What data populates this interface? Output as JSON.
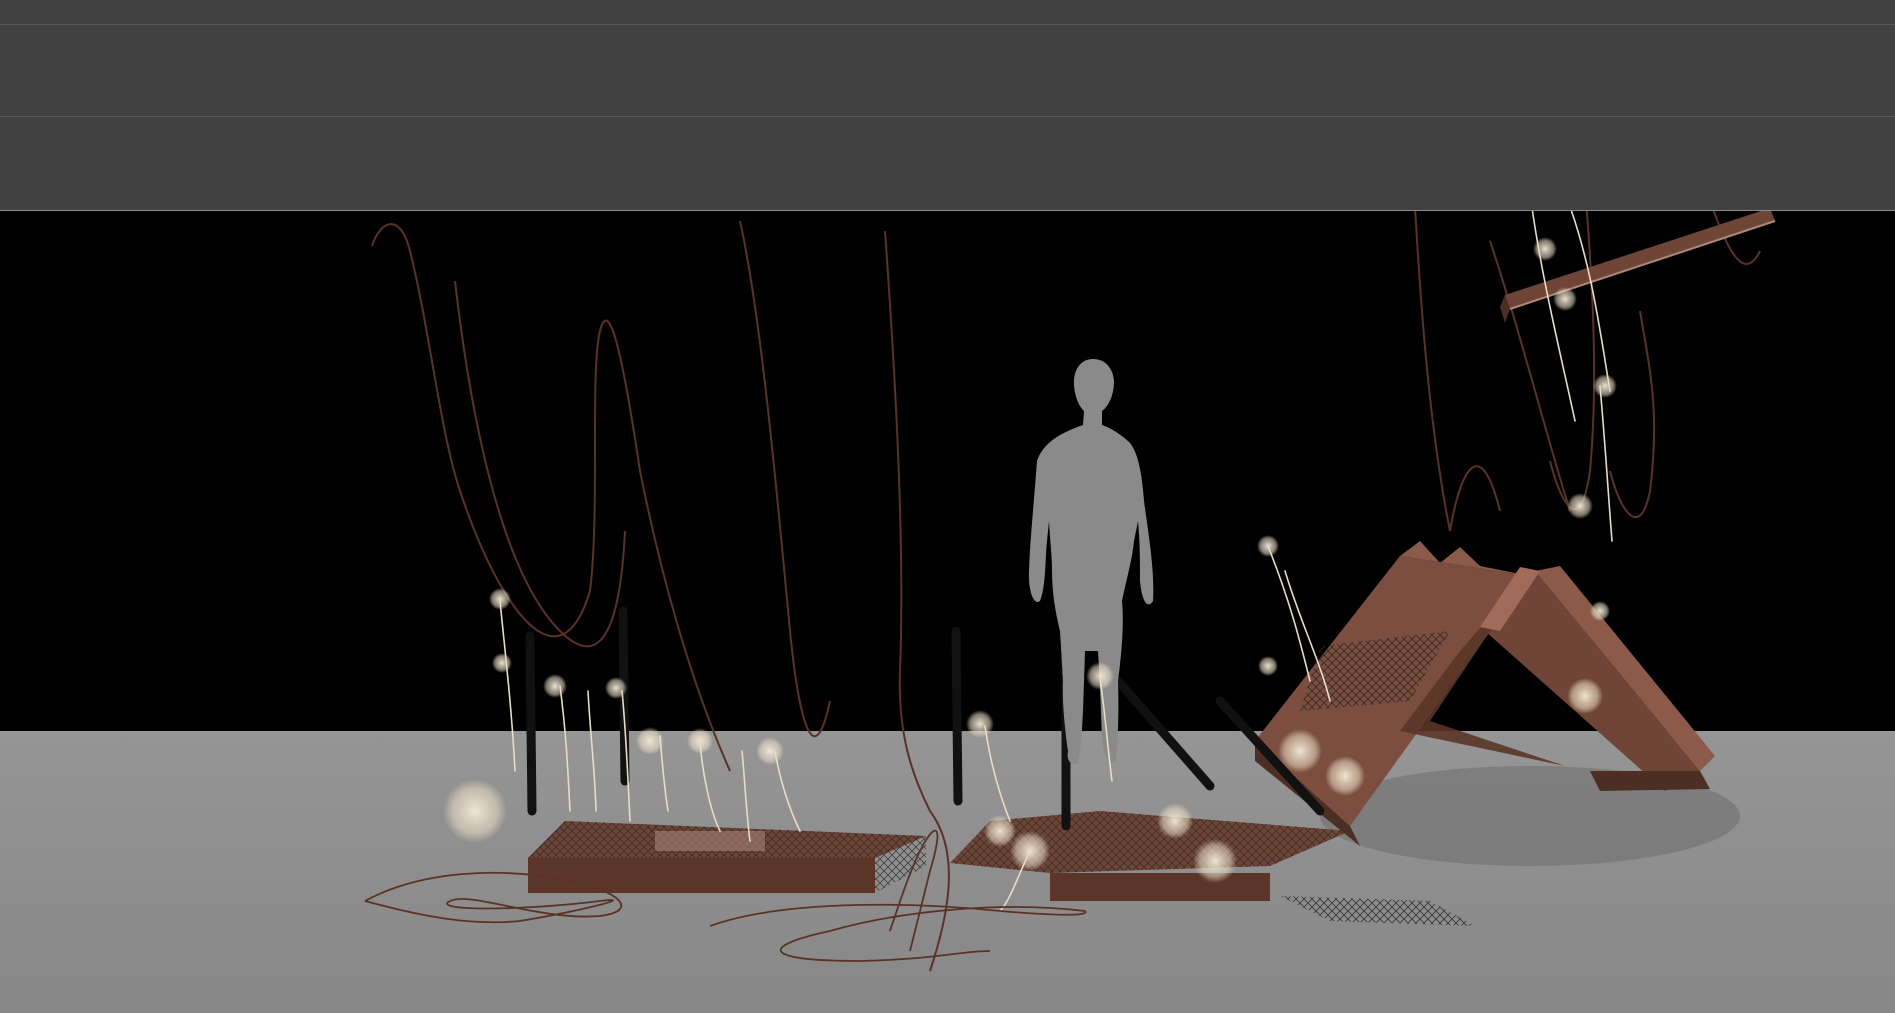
{
  "window": {
    "title": ""
  },
  "canvas": {
    "content": "architectural-collage-rendering",
    "subject": "human-silhouette-among-rusted-steel-platforms",
    "colors": {
      "chrome": "#414141",
      "chrome_line": "#575757",
      "backdrop": "#000000",
      "floor": "#8d8d8d",
      "rust": "#6e4536",
      "rust_light": "#8b5a49",
      "figure": "#8a8a8a",
      "tufts": "#e8dcc4",
      "wire": "#5a3226"
    },
    "icons": [
      "human-silhouette-icon"
    ]
  }
}
